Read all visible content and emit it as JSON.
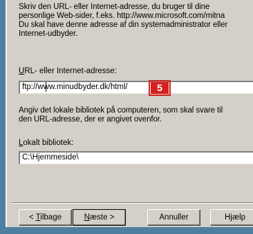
{
  "intro_text": "Skriv den URL- eller Internet-adresse, du bruger til dine\npersonlige Web-sider, f.eks. http://www.microsoft.com/mitna\nDu skal have denne adresse af din systemadministrator eller\nInternet-udbyder.",
  "url_field": {
    "label_mnemonic": "U",
    "label_rest": "RL- eller Internet-adresse:",
    "value": "ftp://www.minudbyder.dk/html/"
  },
  "badge": "5",
  "dir_instructions": "Angiv det lokale bibliotek på computeren, som skal svare til\nden URL-adresse, der er angivet ovenfor.",
  "dir_field": {
    "label_mnemonic": "L",
    "label_rest": "okalt bibliotek:",
    "value": "C:\\Hjemmeside\\"
  },
  "buttons": {
    "back_prefix": "< ",
    "back_mnemonic": "T",
    "back_rest": "ilbage",
    "next_mnemonic": "N",
    "next_rest": "æste >",
    "cancel": "Annuller",
    "help": "Hjælp"
  }
}
